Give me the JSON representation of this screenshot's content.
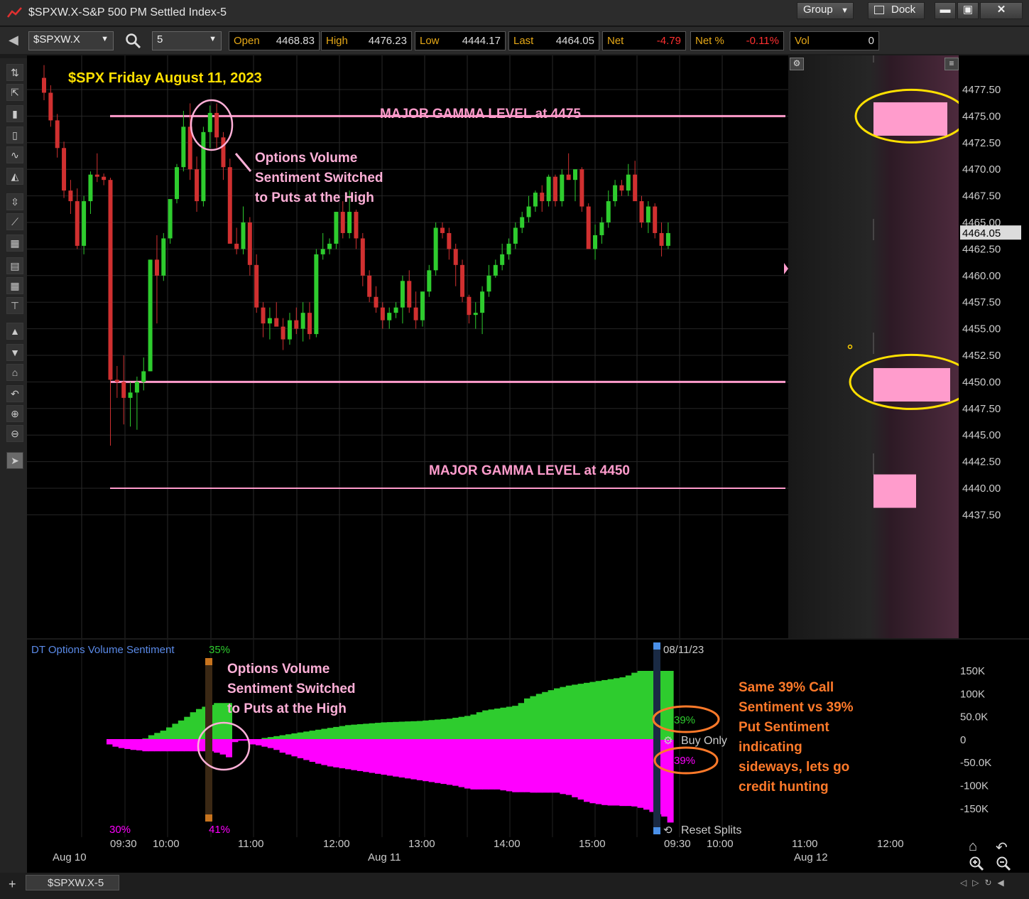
{
  "window": {
    "title": "$SPXW.X-S&P 500 PM Settled Index-5",
    "group_label": "Group",
    "dock_label": "Dock",
    "min_icon": "minimize-icon",
    "max_icon": "maximize-icon",
    "close_icon": "close-icon"
  },
  "toolbar": {
    "symbol": "$SPXW.X",
    "interval": "5",
    "quote": [
      {
        "label": "Open",
        "value": "4468.83",
        "color": "#dddddd"
      },
      {
        "label": "High",
        "value": "4476.23",
        "color": "#dddddd"
      },
      {
        "label": "Low",
        "value": "4444.17",
        "color": "#dddddd"
      },
      {
        "label": "Last",
        "value": "4464.05",
        "color": "#dddddd"
      },
      {
        "label": "Net",
        "value": "-4.79",
        "color": "#ff3030"
      },
      {
        "label": "Net %",
        "value": "-0.11%",
        "color": "#ff3030"
      },
      {
        "label": "Vol",
        "value": "0",
        "color": "#dddddd"
      }
    ]
  },
  "left_tools": [
    "crosshair-icon",
    "drag-icon",
    "candle-icon",
    "bar-icon",
    "line-icon",
    "area-icon",
    "fit-icon",
    "draw-line-icon",
    "grid-icon",
    "table-icon",
    "small-grid-icon",
    "hline-icon",
    "up-icon",
    "down-icon",
    "home-icon",
    "undo-icon",
    "zoom-in-icon",
    "zoom-out-icon",
    "pointer-icon"
  ],
  "chart": {
    "annotation_title": "$SPX Friday August 11, 2023",
    "gamma_upper_label": "MAJOR GAMMA LEVEL at 4475",
    "gamma_lower_label": "MAJOR GAMMA LEVEL at 4450",
    "note_top": [
      "Options Volume",
      "Sentiment Switched",
      "to Puts at the High"
    ],
    "price_label": "4464.05",
    "colors": {
      "up": "#2ecc2e",
      "down": "#d03030",
      "gamma": "#ff9ccc",
      "annot": "#ffe000",
      "note": "#ffb0d8"
    }
  },
  "chart_data": [
    {
      "type": "candlestick",
      "title": "$SPX Friday August 11, 2023",
      "y_ticks": [
        "4477.50",
        "4475.00",
        "4472.50",
        "4470.00",
        "4467.50",
        "4465.00",
        "4462.50",
        "4460.00",
        "4457.50",
        "4455.00",
        "4452.50",
        "4450.00",
        "4447.50",
        "4445.00",
        "4442.50",
        "4440.00",
        "4437.50"
      ],
      "ylim": [
        4436.5,
        4478.5
      ],
      "x_ticks": [
        "09:30",
        "10:00",
        "11:00",
        "12:00",
        "13:00",
        "14:00",
        "15:00",
        "09:30",
        "10:00",
        "11:00",
        "12:00"
      ],
      "date_labels": [
        "Aug 10",
        "Aug 11",
        "Aug 12"
      ],
      "horizontal_levels": [
        4475,
        4450,
        4440
      ],
      "last": 4464.05,
      "candles": [
        [
          4478.6,
          4479.8,
          4476.5,
          4477.2
        ],
        [
          4477.2,
          4477.9,
          4474.0,
          4474.6
        ],
        [
          4474.6,
          4475.2,
          4471.1,
          4472.0
        ],
        [
          4472.0,
          4472.6,
          4467.3,
          4468.0
        ],
        [
          4468.0,
          4469.0,
          4465.8,
          4467.0
        ],
        [
          4467.0,
          4468.2,
          4462.5,
          4462.8
        ],
        [
          4462.8,
          4467.5,
          4462.0,
          4467.0
        ],
        [
          4467.0,
          4469.8,
          4465.8,
          4469.5
        ],
        [
          4469.5,
          4471.5,
          4468.8,
          4469.3
        ],
        [
          4469.3,
          4469.6,
          4468.5,
          4469.0
        ],
        [
          4469.0,
          4469.2,
          4444.0,
          4450.2
        ],
        [
          4450.2,
          4451.5,
          4448.5,
          4450.0
        ],
        [
          4450.0,
          4452.5,
          4446.0,
          4448.5
        ],
        [
          4448.5,
          4450.0,
          4445.8,
          4449.0
        ],
        [
          4449.0,
          4450.5,
          4445.5,
          4450.0
        ],
        [
          4450.0,
          4452.3,
          4449.2,
          4451.0
        ],
        [
          4451.0,
          4461.5,
          4451.0,
          4461.5
        ],
        [
          4461.5,
          4463.8,
          4455.5,
          4460.0
        ],
        [
          4460.0,
          4464.0,
          4459.5,
          4463.5
        ],
        [
          4463.5,
          4467.0,
          4463.0,
          4467.2
        ],
        [
          4467.2,
          4470.5,
          4466.8,
          4470.2
        ],
        [
          4470.2,
          4475.5,
          4469.8,
          4474.0
        ],
        [
          4474.0,
          4476.2,
          4469.0,
          4470.0
        ],
        [
          4470.0,
          4471.2,
          4466.0,
          4467.0
        ],
        [
          4467.0,
          4474.0,
          4466.5,
          4473.5
        ],
        [
          4473.5,
          4476.0,
          4472.0,
          4475.3
        ],
        [
          4475.3,
          4476.2,
          4472.0,
          4473.0
        ],
        [
          4473.0,
          4473.5,
          4469.0,
          4470.2
        ],
        [
          4470.2,
          4471.0,
          4463.0,
          4463.0
        ],
        [
          4463.0,
          4464.5,
          4462.0,
          4462.5
        ],
        [
          4462.5,
          4466.5,
          4462.0,
          4465.0
        ],
        [
          4465.0,
          4465.5,
          4460.0,
          4461.0
        ],
        [
          4461.0,
          4462.0,
          4456.5,
          4457.0
        ],
        [
          4457.0,
          4457.5,
          4454.2,
          4455.5
        ],
        [
          4455.5,
          4457.0,
          4454.0,
          4456.0
        ],
        [
          4456.0,
          4457.5,
          4455.5,
          4455.2
        ],
        [
          4455.2,
          4456.0,
          4453.0,
          4454.0
        ],
        [
          4454.0,
          4456.5,
          4453.5,
          4455.8
        ],
        [
          4455.8,
          4457.0,
          4454.5,
          4455.0
        ],
        [
          4455.0,
          4457.5,
          4453.8,
          4456.5
        ],
        [
          4456.5,
          4457.5,
          4454.0,
          4454.5
        ],
        [
          4454.5,
          4462.5,
          4454.2,
          4462.0
        ],
        [
          4462.0,
          4464.0,
          4461.5,
          4462.5
        ],
        [
          4462.5,
          4463.5,
          4462.0,
          4463.0
        ],
        [
          4463.0,
          4466.0,
          4462.5,
          4466.0
        ],
        [
          4466.0,
          4467.0,
          4463.5,
          4464.0
        ],
        [
          4464.0,
          4468.0,
          4463.5,
          4466.0
        ],
        [
          4466.0,
          4466.2,
          4462.5,
          4463.5
        ],
        [
          4463.5,
          4464.0,
          4459.0,
          4460.0
        ],
        [
          4460.0,
          4460.5,
          4457.5,
          4458.0
        ],
        [
          4458.0,
          4459.0,
          4456.5,
          4457.0
        ],
        [
          4457.0,
          4457.5,
          4455.0,
          4455.8
        ],
        [
          4455.8,
          4457.0,
          4455.0,
          4456.5
        ],
        [
          4456.5,
          4457.5,
          4456.0,
          4457.0
        ],
        [
          4457.0,
          4460.0,
          4455.5,
          4459.5
        ],
        [
          4459.5,
          4460.5,
          4456.5,
          4457.0
        ],
        [
          4457.0,
          4458.5,
          4455.0,
          4455.8
        ],
        [
          4455.8,
          4458.5,
          4455.2,
          4458.5
        ],
        [
          4458.5,
          4461.0,
          4458.0,
          4460.5
        ],
        [
          4460.5,
          4465.0,
          4460.0,
          4464.5
        ],
        [
          4464.5,
          4465.0,
          4463.5,
          4464.0
        ],
        [
          4464.0,
          4464.5,
          4461.5,
          4462.5
        ],
        [
          4462.5,
          4463.0,
          4459.0,
          4461.0
        ],
        [
          4461.0,
          4461.5,
          4457.5,
          4458.0
        ],
        [
          4458.0,
          4458.2,
          4455.5,
          4456.3
        ],
        [
          4456.3,
          4457.5,
          4455.0,
          4456.5
        ],
        [
          4456.5,
          4459.0,
          4454.5,
          4458.5
        ],
        [
          4458.5,
          4461.0,
          4458.0,
          4460.0
        ],
        [
          4460.0,
          4461.5,
          4459.8,
          4461.0
        ],
        [
          4461.0,
          4463.0,
          4460.5,
          4462.0
        ],
        [
          4462.0,
          4463.5,
          4461.5,
          4463.0
        ],
        [
          4463.0,
          4465.0,
          4462.5,
          4464.5
        ],
        [
          4464.5,
          4466.0,
          4464.0,
          4465.5
        ],
        [
          4465.5,
          4467.5,
          4465.0,
          4466.5
        ],
        [
          4466.5,
          4468.0,
          4466.0,
          4467.8
        ],
        [
          4467.8,
          4468.5,
          4466.0,
          4467.0
        ],
        [
          4467.0,
          4469.5,
          4466.5,
          4469.3
        ],
        [
          4469.3,
          4469.5,
          4466.5,
          4467.0
        ],
        [
          4467.0,
          4470.0,
          4466.5,
          4469.5
        ],
        [
          4469.5,
          4471.5,
          4469.0,
          4469.0
        ],
        [
          4469.0,
          4470.0,
          4467.0,
          4470.0
        ],
        [
          4470.0,
          4470.2,
          4466.0,
          4466.5
        ],
        [
          4466.5,
          4466.8,
          4463.0,
          4462.5
        ],
        [
          4462.5,
          4464.8,
          4461.5,
          4463.8
        ],
        [
          4463.8,
          4465.5,
          4463.0,
          4465.0
        ],
        [
          4465.0,
          4468.0,
          4464.5,
          4467.0
        ],
        [
          4467.0,
          4469.0,
          4466.5,
          4468.5
        ],
        [
          4468.5,
          4469.0,
          4467.5,
          4468.0
        ],
        [
          4468.0,
          4470.5,
          4467.5,
          4469.5
        ],
        [
          4469.5,
          4470.8,
          4468.0,
          4467.0
        ],
        [
          4467.0,
          4467.5,
          4464.5,
          4465.0
        ],
        [
          4465.0,
          4467.0,
          4464.0,
          4466.5
        ],
        [
          4466.5,
          4466.8,
          4463.5,
          4464.0
        ],
        [
          4464.0,
          4465.0,
          4461.8,
          4462.8
        ],
        [
          4462.8,
          4465.0,
          4462.5,
          4464.0
        ]
      ]
    },
    {
      "type": "area",
      "title": "DT Options Volume Sentiment",
      "y_ticks": [
        "150K",
        "100K",
        "50.0K",
        "0",
        "-50.0K",
        "-100K",
        "-150K"
      ],
      "ylim": [
        -180000,
        180000
      ],
      "calls": [
        0,
        0,
        0,
        0,
        0,
        0,
        3000,
        10000,
        15000,
        20000,
        27000,
        35000,
        42000,
        50000,
        60000,
        67000,
        72000,
        76000,
        80000,
        80000,
        80000,
        0,
        0,
        0,
        0,
        0,
        4000,
        6000,
        8000,
        10000,
        12000,
        14000,
        16000,
        18000,
        20000,
        22000,
        24000,
        26000,
        28000,
        30000,
        32000,
        33000,
        34000,
        35000,
        36000,
        37000,
        38000,
        38500,
        39000,
        39500,
        40000,
        40500,
        41000,
        42000,
        43000,
        44000,
        45000,
        46000,
        48000,
        50000,
        52000,
        55000,
        60000,
        64000,
        66000,
        68000,
        70000,
        72000,
        74000,
        80000,
        90000,
        95000,
        100000,
        104000,
        108000,
        112000,
        115000,
        118000,
        120000,
        122000,
        124000,
        126000,
        128000,
        130000,
        132000,
        134000,
        136000,
        140000,
        146000,
        150000,
        150000,
        150000,
        150000,
        150000,
        150000
      ],
      "puts": [
        -10000,
        -15000,
        -18000,
        -20000,
        -22000,
        -23000,
        -25000,
        -25000,
        -25000,
        -25000,
        -25000,
        -25000,
        -25000,
        -25000,
        -25000,
        -25000,
        -25000,
        -25000,
        -28000,
        -32000,
        -38000,
        -5000,
        -2000,
        -2000,
        -10000,
        -12000,
        -15000,
        -18000,
        -22000,
        -28000,
        -32000,
        -36000,
        -40000,
        -44000,
        -48000,
        -52000,
        -55000,
        -58000,
        -60000,
        -62000,
        -64000,
        -66000,
        -68000,
        -70000,
        -72000,
        -74000,
        -76000,
        -78000,
        -80000,
        -82000,
        -84000,
        -86000,
        -88000,
        -90000,
        -92000,
        -94000,
        -96000,
        -98000,
        -100000,
        -103000,
        -106000,
        -108000,
        -108000,
        -108000,
        -108000,
        -108000,
        -110000,
        -112000,
        -114000,
        -114000,
        -114000,
        -115000,
        -115000,
        -115000,
        -115000,
        -115000,
        -118000,
        -120000,
        -125000,
        -130000,
        -135000,
        -138000,
        -140000,
        -142000,
        -143000,
        -143000,
        -144000,
        -144000,
        -145000,
        -148000,
        -152000,
        -157000,
        -162000,
        -167000,
        -180000
      ]
    }
  ],
  "lower": {
    "title": "DT Options Volume Sentiment",
    "pct_top": "35%",
    "pct_bottom_left": "30%",
    "pct_bottom_mid": "41%",
    "date": "08/11/23",
    "b_call": "B-39%",
    "b_put": "B-39%",
    "buy_only": "Buy Only",
    "reset_splits": "Reset Splits",
    "note_left": [
      "Options Volume",
      "Sentiment Switched",
      "to Puts at the High"
    ],
    "note_right": [
      "Same 39% Call",
      "Sentiment vs 39%",
      "Put Sentiment",
      "indicating",
      "sideways, lets go",
      "credit hunting"
    ],
    "colors": {
      "calls": "#2ecc2e",
      "puts": "#ff00ff",
      "note": "#ff7a2a"
    }
  },
  "x_axis": {
    "times": [
      "09:30",
      "10:00",
      "11:00",
      "12:00",
      "13:00",
      "14:00",
      "15:00",
      "09:30",
      "10:00",
      "11:00",
      "12:00"
    ],
    "dates": [
      "Aug 10",
      "Aug 11",
      "Aug 12"
    ]
  },
  "tab": {
    "label": "$SPXW.X-5"
  }
}
